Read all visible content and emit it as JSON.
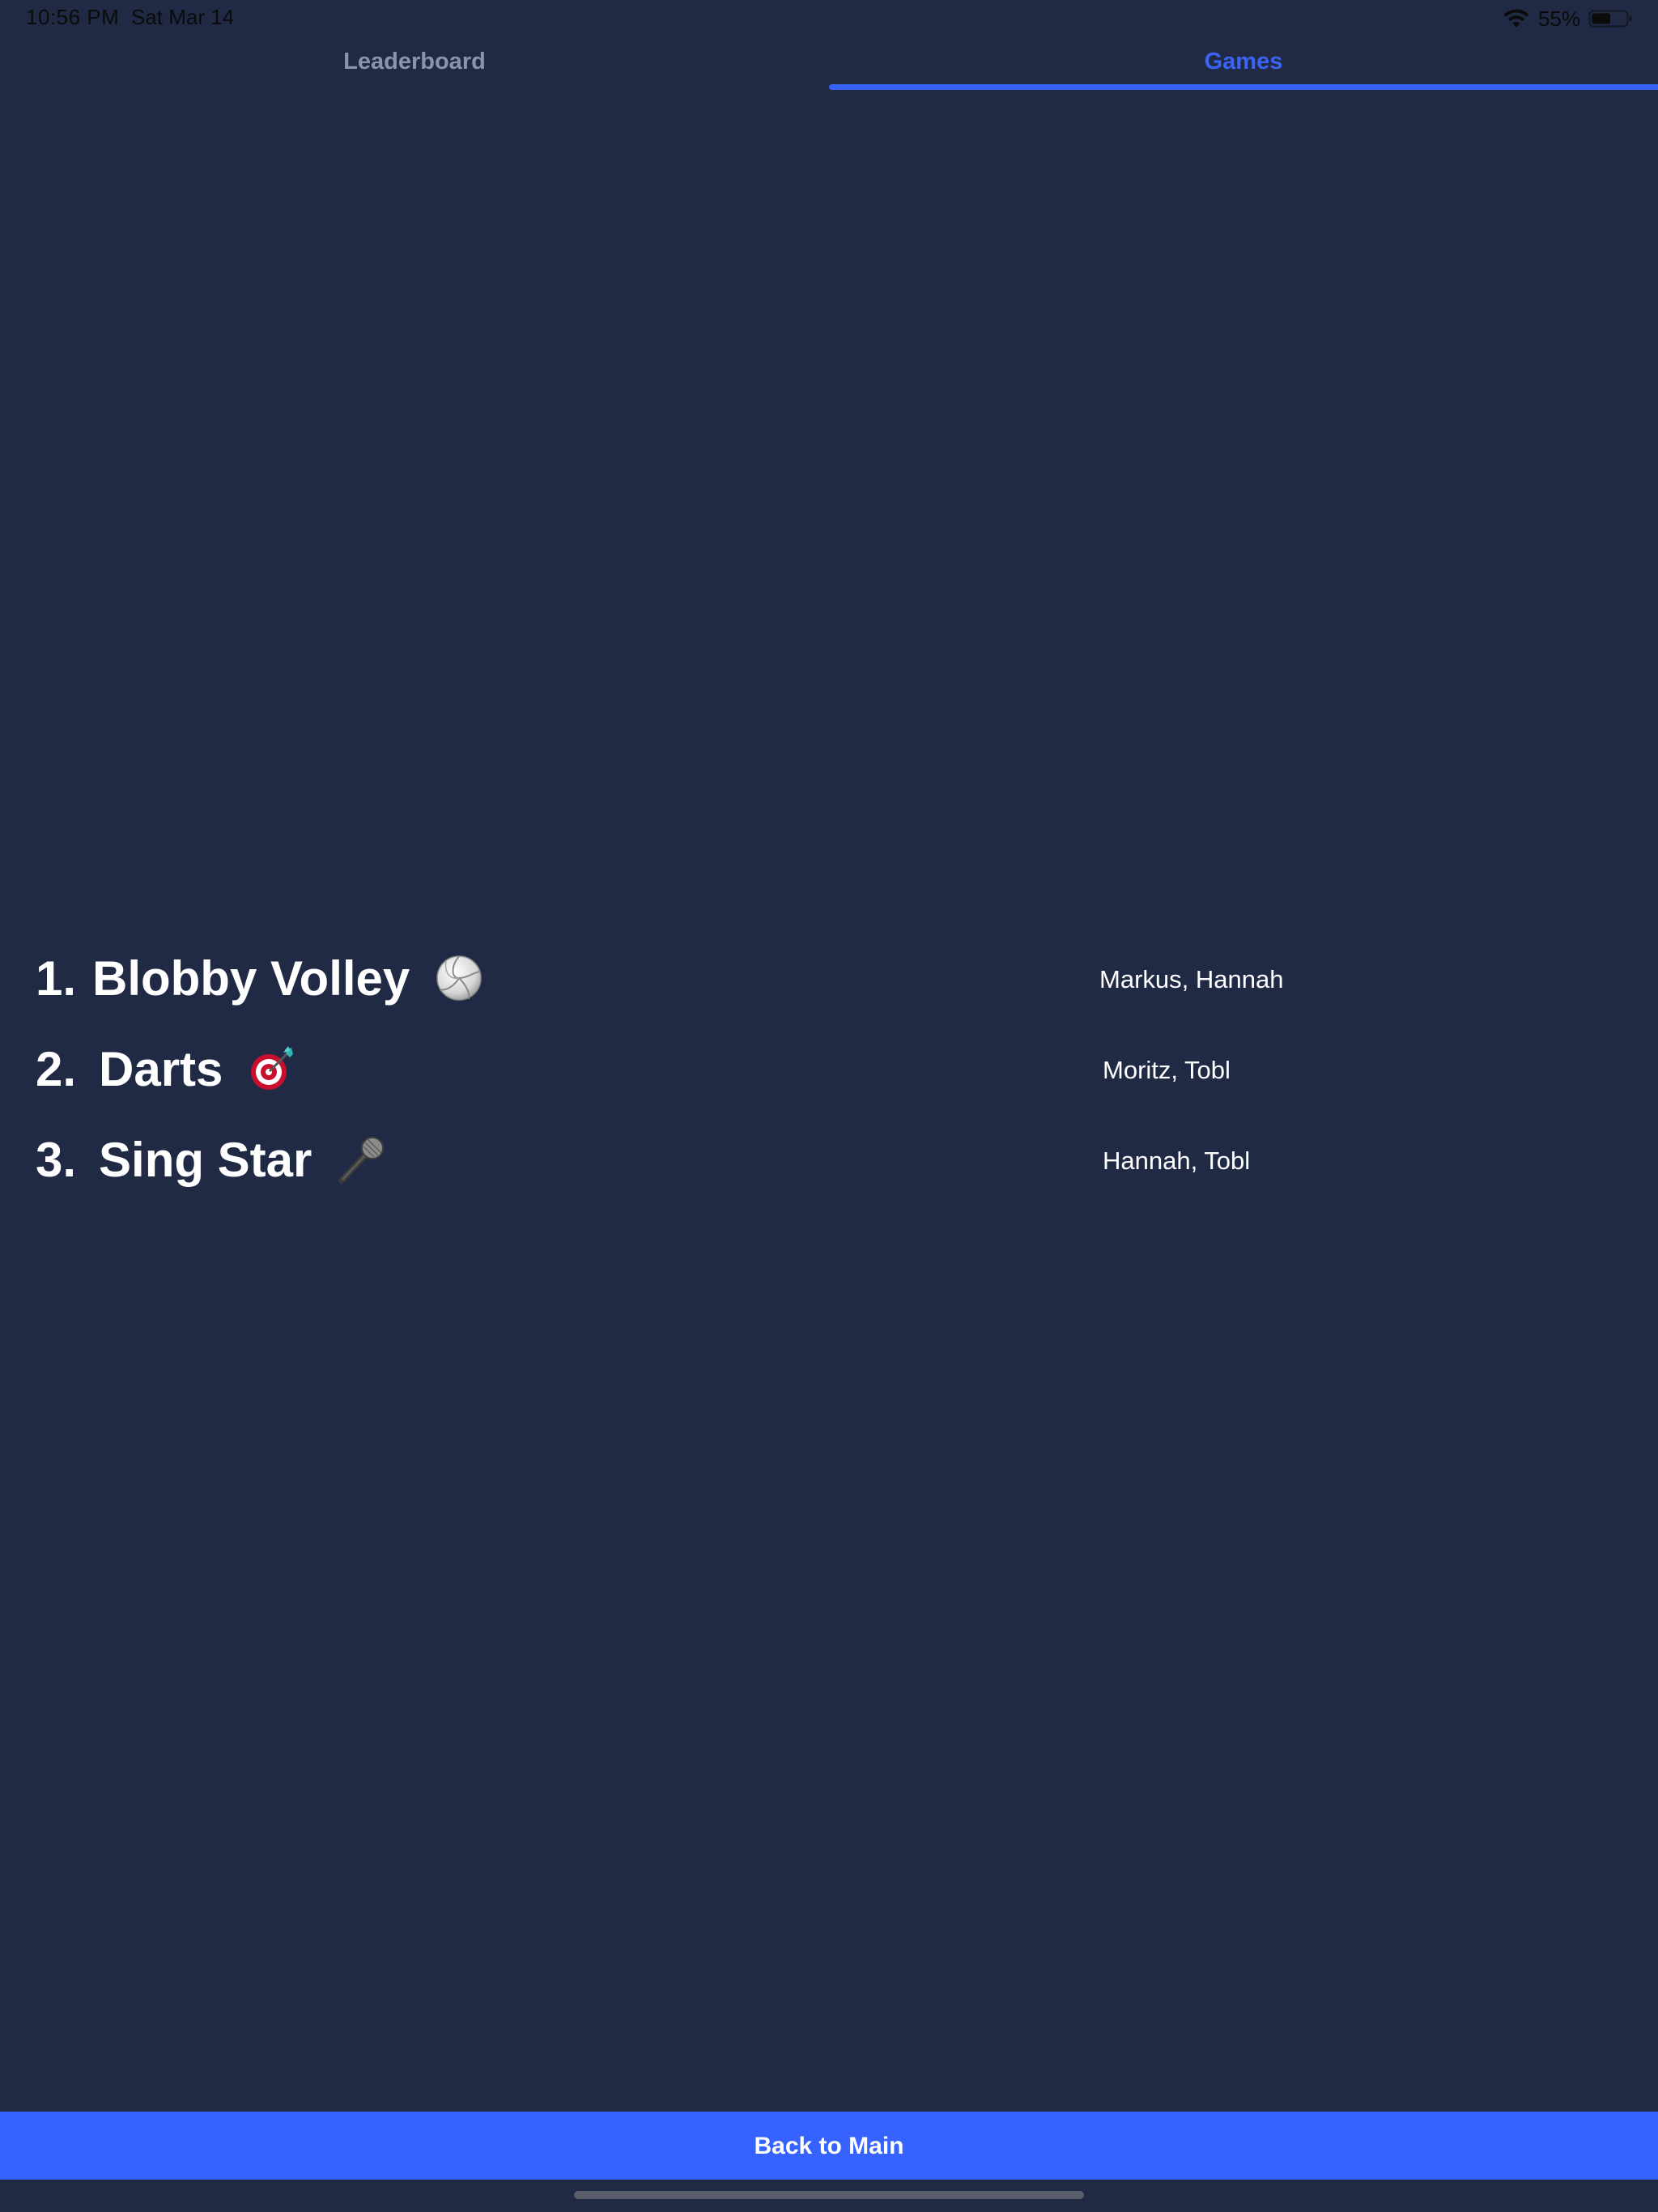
{
  "status_bar": {
    "time": "10:56 PM",
    "date": "Sat Mar 14",
    "battery_percent": "55%",
    "battery_level": 0.55,
    "icons": [
      "wifi-icon",
      "battery-icon"
    ]
  },
  "tabs": [
    {
      "label": "Leaderboard",
      "selected": false
    },
    {
      "label": "Games",
      "selected": true
    }
  ],
  "colors": {
    "background": "#212a45",
    "accent": "#3663ff",
    "tab_inactive": "#8a94ad",
    "text": "#ffffff"
  },
  "games": [
    {
      "rank": "1.",
      "name": "Blobby Volley",
      "icon": "volleyball-icon",
      "players": "Markus, Hannah"
    },
    {
      "rank": "2.",
      "name": "Darts",
      "icon": "dart-target-icon",
      "players": "Moritz, Tobl"
    },
    {
      "rank": "3.",
      "name": "Sing Star",
      "icon": "microphone-icon",
      "players": "Hannah, Tobl"
    }
  ],
  "footer": {
    "back_button_label": "Back to Main"
  }
}
